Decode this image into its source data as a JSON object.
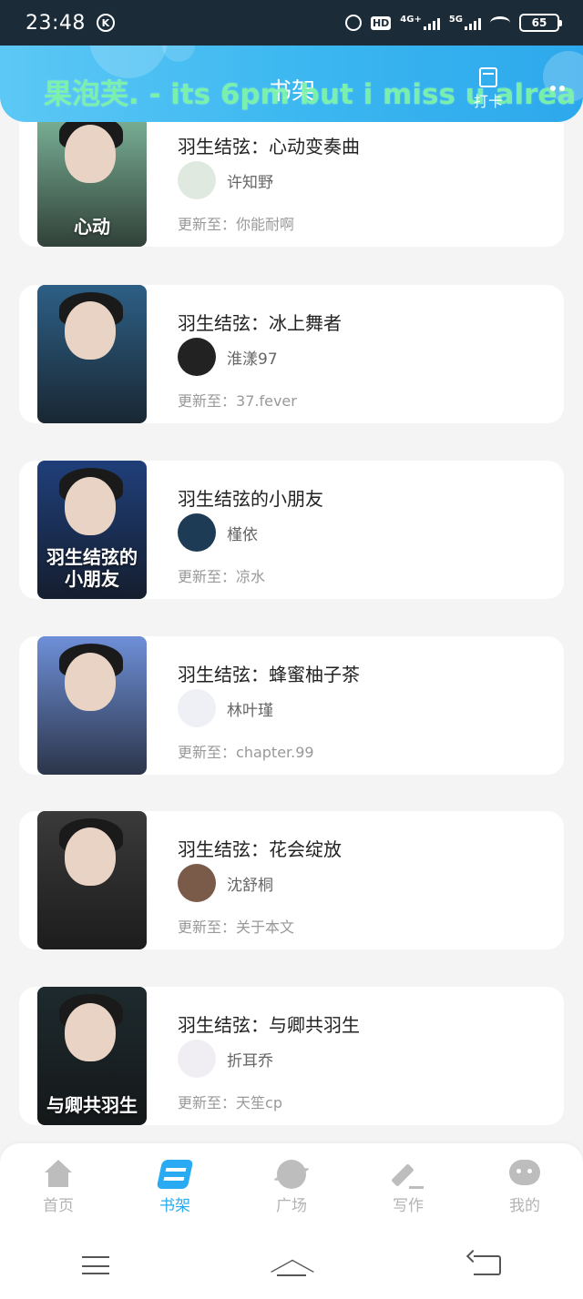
{
  "status_bar": {
    "time": "23:48",
    "k_badge": "K",
    "hd_badge": "HD",
    "net1": "4G+",
    "net2": "5G",
    "battery": "65"
  },
  "header": {
    "title": "书架",
    "marquee": "果泡芙. - its 6pm but i miss u alrea",
    "checkin_label": "打卡",
    "accent_color": "#3ab6f0"
  },
  "update_prefix": "更新至：",
  "books": [
    {
      "title": "羽生结弦：心动变奏曲",
      "author": "许知野",
      "latest": "你能耐啊",
      "cover_text": "心动",
      "cover_color": "#7fb89c"
    },
    {
      "title": "羽生结弦：冰上舞者",
      "author": "淮漾97",
      "latest": "37.fever",
      "cover_text": "",
      "cover_color": "#2d5f86"
    },
    {
      "title": "羽生结弦的小朋友",
      "author": "槿依",
      "latest": "凉水",
      "cover_text": "羽生结弦的小朋友",
      "cover_color": "#1f3f7a"
    },
    {
      "title": "羽生结弦：蜂蜜柚子茶",
      "author": "林叶瑾",
      "latest": "chapter.99",
      "cover_text": "",
      "cover_color": "#6e8fd8"
    },
    {
      "title": "羽生结弦：花会绽放",
      "author": "沈舒桐",
      "latest": "关于本文",
      "cover_text": "",
      "cover_color": "#3a3a3a"
    },
    {
      "title": "羽生结弦：与卿共羽生",
      "author": "折耳乔",
      "latest": "天笙cp",
      "cover_text": "与卿共羽生",
      "cover_color": "#1e2a2e"
    }
  ],
  "bottom_nav": {
    "items": [
      {
        "label": "首页",
        "icon": "home-icon"
      },
      {
        "label": "书架",
        "icon": "bookshelf-icon",
        "active": true
      },
      {
        "label": "广场",
        "icon": "planet-icon"
      },
      {
        "label": "写作",
        "icon": "pen-icon"
      },
      {
        "label": "我的",
        "icon": "chat-bubble-icon"
      }
    ]
  }
}
